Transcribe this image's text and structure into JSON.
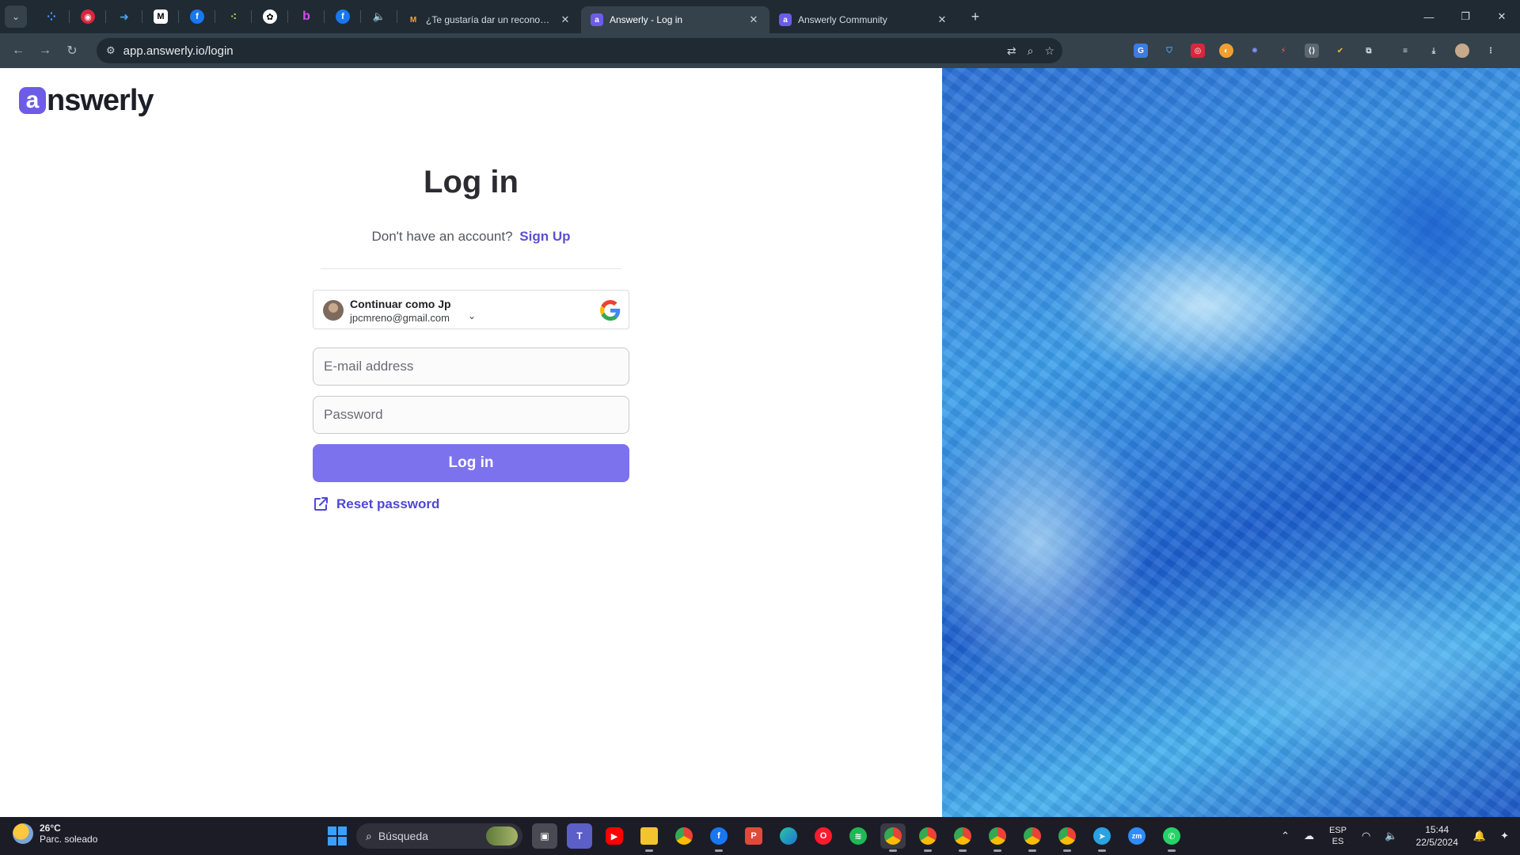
{
  "browser": {
    "tabs": [
      {
        "title": "¿Te gustaría dar un reconocimie",
        "favicon_color": "#f5a623"
      },
      {
        "title": "Answerly - Log in",
        "favicon_color": "#6d5ce8",
        "active": true
      },
      {
        "title": "Answerly Community",
        "favicon_color": "#6d5ce8"
      }
    ],
    "url": "app.answerly.io/login"
  },
  "page": {
    "logo": {
      "mark": "a",
      "text": "nswerly"
    },
    "title": "Log in",
    "signup_prompt": "Don't have an account?",
    "signup_link": "Sign Up",
    "google": {
      "name": "Continuar como Jp",
      "email": "jpcmreno@gmail.com"
    },
    "email_placeholder": "E-mail address",
    "password_placeholder": "Password",
    "login_button": "Log in",
    "reset_password": "Reset password"
  },
  "colors": {
    "accent": "#7d72ee",
    "link": "#5b4fd6",
    "brand": "#6d5ce8"
  },
  "taskbar": {
    "weather_temp": "26°C",
    "weather_desc": "Parc. soleado",
    "search_placeholder": "Búsqueda",
    "lang_line1": "ESP",
    "lang_line2": "ES",
    "time": "15:44",
    "date": "22/5/2024"
  }
}
